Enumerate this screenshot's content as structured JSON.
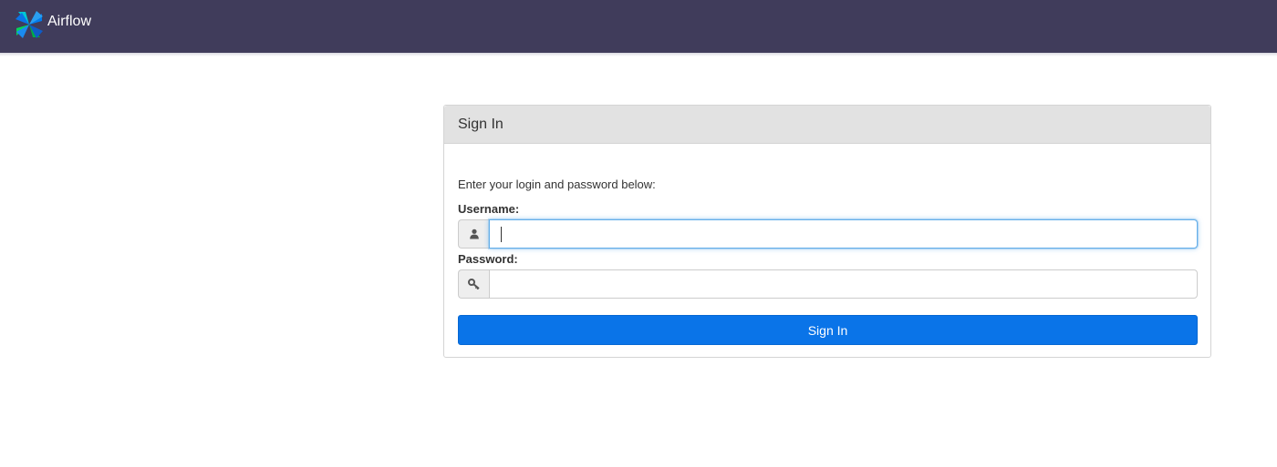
{
  "navbar": {
    "brand_name": "Airflow",
    "logo_icon": "airflow-pinwheel-logo"
  },
  "panel": {
    "title": "Sign In",
    "intro": "Enter your login and password below:",
    "username": {
      "label": "Username:",
      "value": "",
      "icon": "user-icon",
      "focused": true
    },
    "password": {
      "label": "Password:",
      "value": "",
      "icon": "key-icon"
    },
    "submit_label": "Sign In"
  },
  "colors": {
    "navbar": "#403c5b",
    "primary_button": "#0a74e8",
    "panel_heading": "#e2e2e2",
    "focus_border": "#66afe9"
  }
}
